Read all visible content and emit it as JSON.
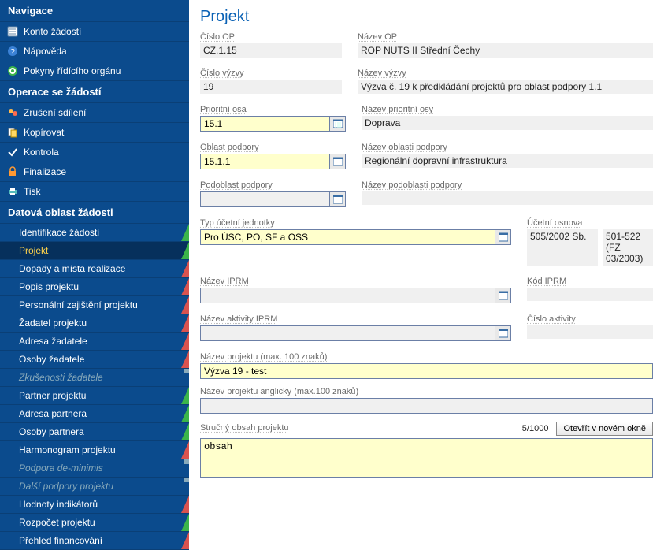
{
  "nav": {
    "header1": "Navigace",
    "konto": "Konto žádostí",
    "napoveda": "Nápověda",
    "pokyny": "Pokyny řídícího orgánu",
    "header2": "Operace se žádostí",
    "zruseni": "Zrušení sdílení",
    "kopirovat": "Kopírovat",
    "kontrola": "Kontrola",
    "finalizace": "Finalizace",
    "tisk": "Tisk",
    "header3": "Datová oblast žádosti",
    "items": [
      "Identifikace žádosti",
      "Projekt",
      "Dopady a místa realizace",
      "Popis projektu",
      "Personální zajištění projektu",
      "Žadatel projektu",
      "Adresa žadatele",
      "Osoby žadatele",
      "Zkušenosti žadatele",
      "Partner projektu",
      "Adresa partnera",
      "Osoby partnera",
      "Harmonogram projektu",
      "Podpora de-minimis",
      "Další podpory projektu",
      "Hodnoty indikátorů",
      "Rozpočet projektu",
      "Přehled financování"
    ]
  },
  "page": {
    "title": "Projekt",
    "cislo_op_label": "Číslo OP",
    "cislo_op": "CZ.1.15",
    "nazev_op_label": "Název OP",
    "nazev_op": "ROP NUTS II Střední Čechy",
    "cislo_vyzvy_label": "Číslo výzvy",
    "cislo_vyzvy": "19",
    "nazev_vyzvy_label": "Název výzvy",
    "nazev_vyzvy": "Výzva č. 19 k předkládání projektů pro oblast podpory 1.1",
    "prioritni_osa_label": "Prioritní osa",
    "prioritni_osa": "15.1",
    "nazev_prioritni_osy_label": "Název prioritní osy",
    "nazev_prioritni_osy": "Doprava",
    "oblast_podpory_label": "Oblast podpory",
    "oblast_podpory": "15.1.1",
    "nazev_oblasti_label": "Název oblasti podpory",
    "nazev_oblasti": "Regionální dopravní infrastruktura",
    "podoblast_label": "Podoblast podpory",
    "podoblast": "",
    "nazev_podoblasti_label": "Název podoblasti podpory",
    "nazev_podoblasti": "",
    "typ_uj_label": "Typ účetní jednotky",
    "typ_uj": "Pro ÚSC, PO, SF a OSS",
    "ucetni_osnova_label": "Účetní osnova",
    "ucetni_osnova1": "505/2002 Sb.",
    "ucetni_osnova2": "501-522 (FZ 03/2003)",
    "nazev_iprm_label": "Název IPRM",
    "nazev_iprm": "",
    "kod_iprm_label": "Kód IPRM",
    "kod_iprm": "",
    "nazev_aktivity_label": "Název aktivity IPRM",
    "nazev_aktivity": "",
    "cislo_aktivity_label": "Číslo aktivity",
    "cislo_aktivity": "",
    "nazev_projektu_label": "Název projektu (max. 100 znaků)",
    "nazev_projektu": "Výzva 19 - test",
    "nazev_projektu_en_label": "Název projektu anglicky (max.100 znaků)",
    "nazev_projektu_en": "",
    "strucny_obsah_label": "Stručný obsah projektu",
    "counter": "5/1000",
    "open_btn": "Otevřít v novém okně",
    "strucny_obsah": "obsah"
  }
}
